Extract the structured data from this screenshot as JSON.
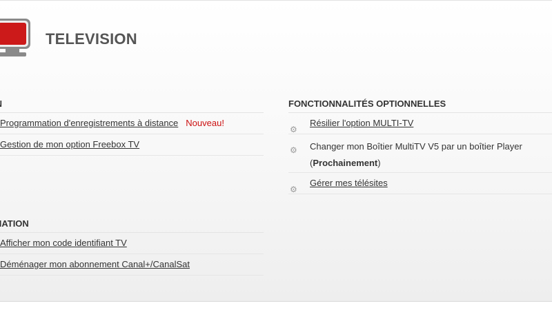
{
  "page": {
    "title": "TELEVISION"
  },
  "colors": {
    "accent": "#cc1111",
    "tv_body": "#cc1a1a",
    "tv_frame": "#8a8a8a"
  },
  "sections": {
    "left_top": {
      "heading": "TION",
      "items": [
        {
          "label": "Programmation d'enregistrements à distance",
          "badge": "Nouveau!"
        },
        {
          "label": "Gestion de mon option Freebox TV"
        }
      ]
    },
    "left_bottom": {
      "heading": "ORMATION",
      "items": [
        {
          "label": "Afficher mon code identifiant TV"
        },
        {
          "label": "Déménager mon abonnement Canal+/CanalSat"
        }
      ]
    },
    "right": {
      "heading": "FONCTIONNALITÉS OPTIONNELLES",
      "items": [
        {
          "label": "Résilier l'option MULTI-TV",
          "icon": "gear-icon"
        },
        {
          "label": "Changer mon Boîtier MultiTV V5 par un boîtier Player",
          "note_open": "(",
          "note_bold": "Prochainement",
          "note_close": ")",
          "icon": "gear-icon"
        },
        {
          "label": "Gérer mes télésites",
          "icon": "gear-icon"
        }
      ]
    }
  }
}
